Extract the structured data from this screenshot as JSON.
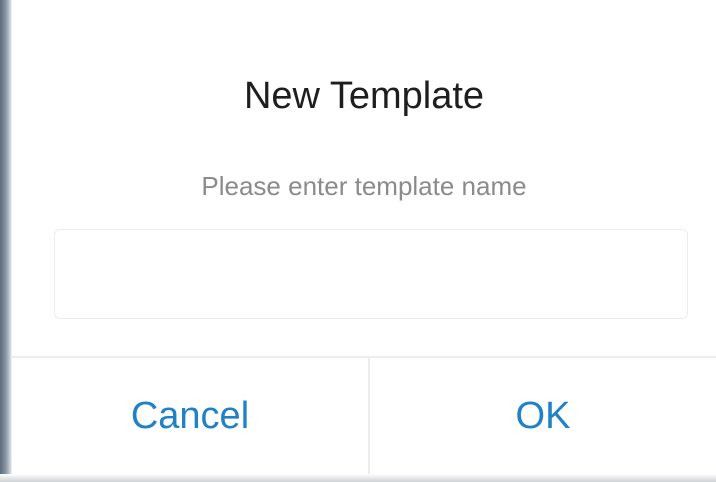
{
  "dialog": {
    "title": "New Template",
    "message": "Please enter template name",
    "name_input": {
      "value": "",
      "placeholder": ""
    },
    "buttons": {
      "cancel_label": "Cancel",
      "ok_label": "OK"
    }
  },
  "colors": {
    "accent": "#1f82c8",
    "title_text": "#1e1e1e",
    "message_text": "#8b8b8b",
    "divider": "#ececec"
  }
}
